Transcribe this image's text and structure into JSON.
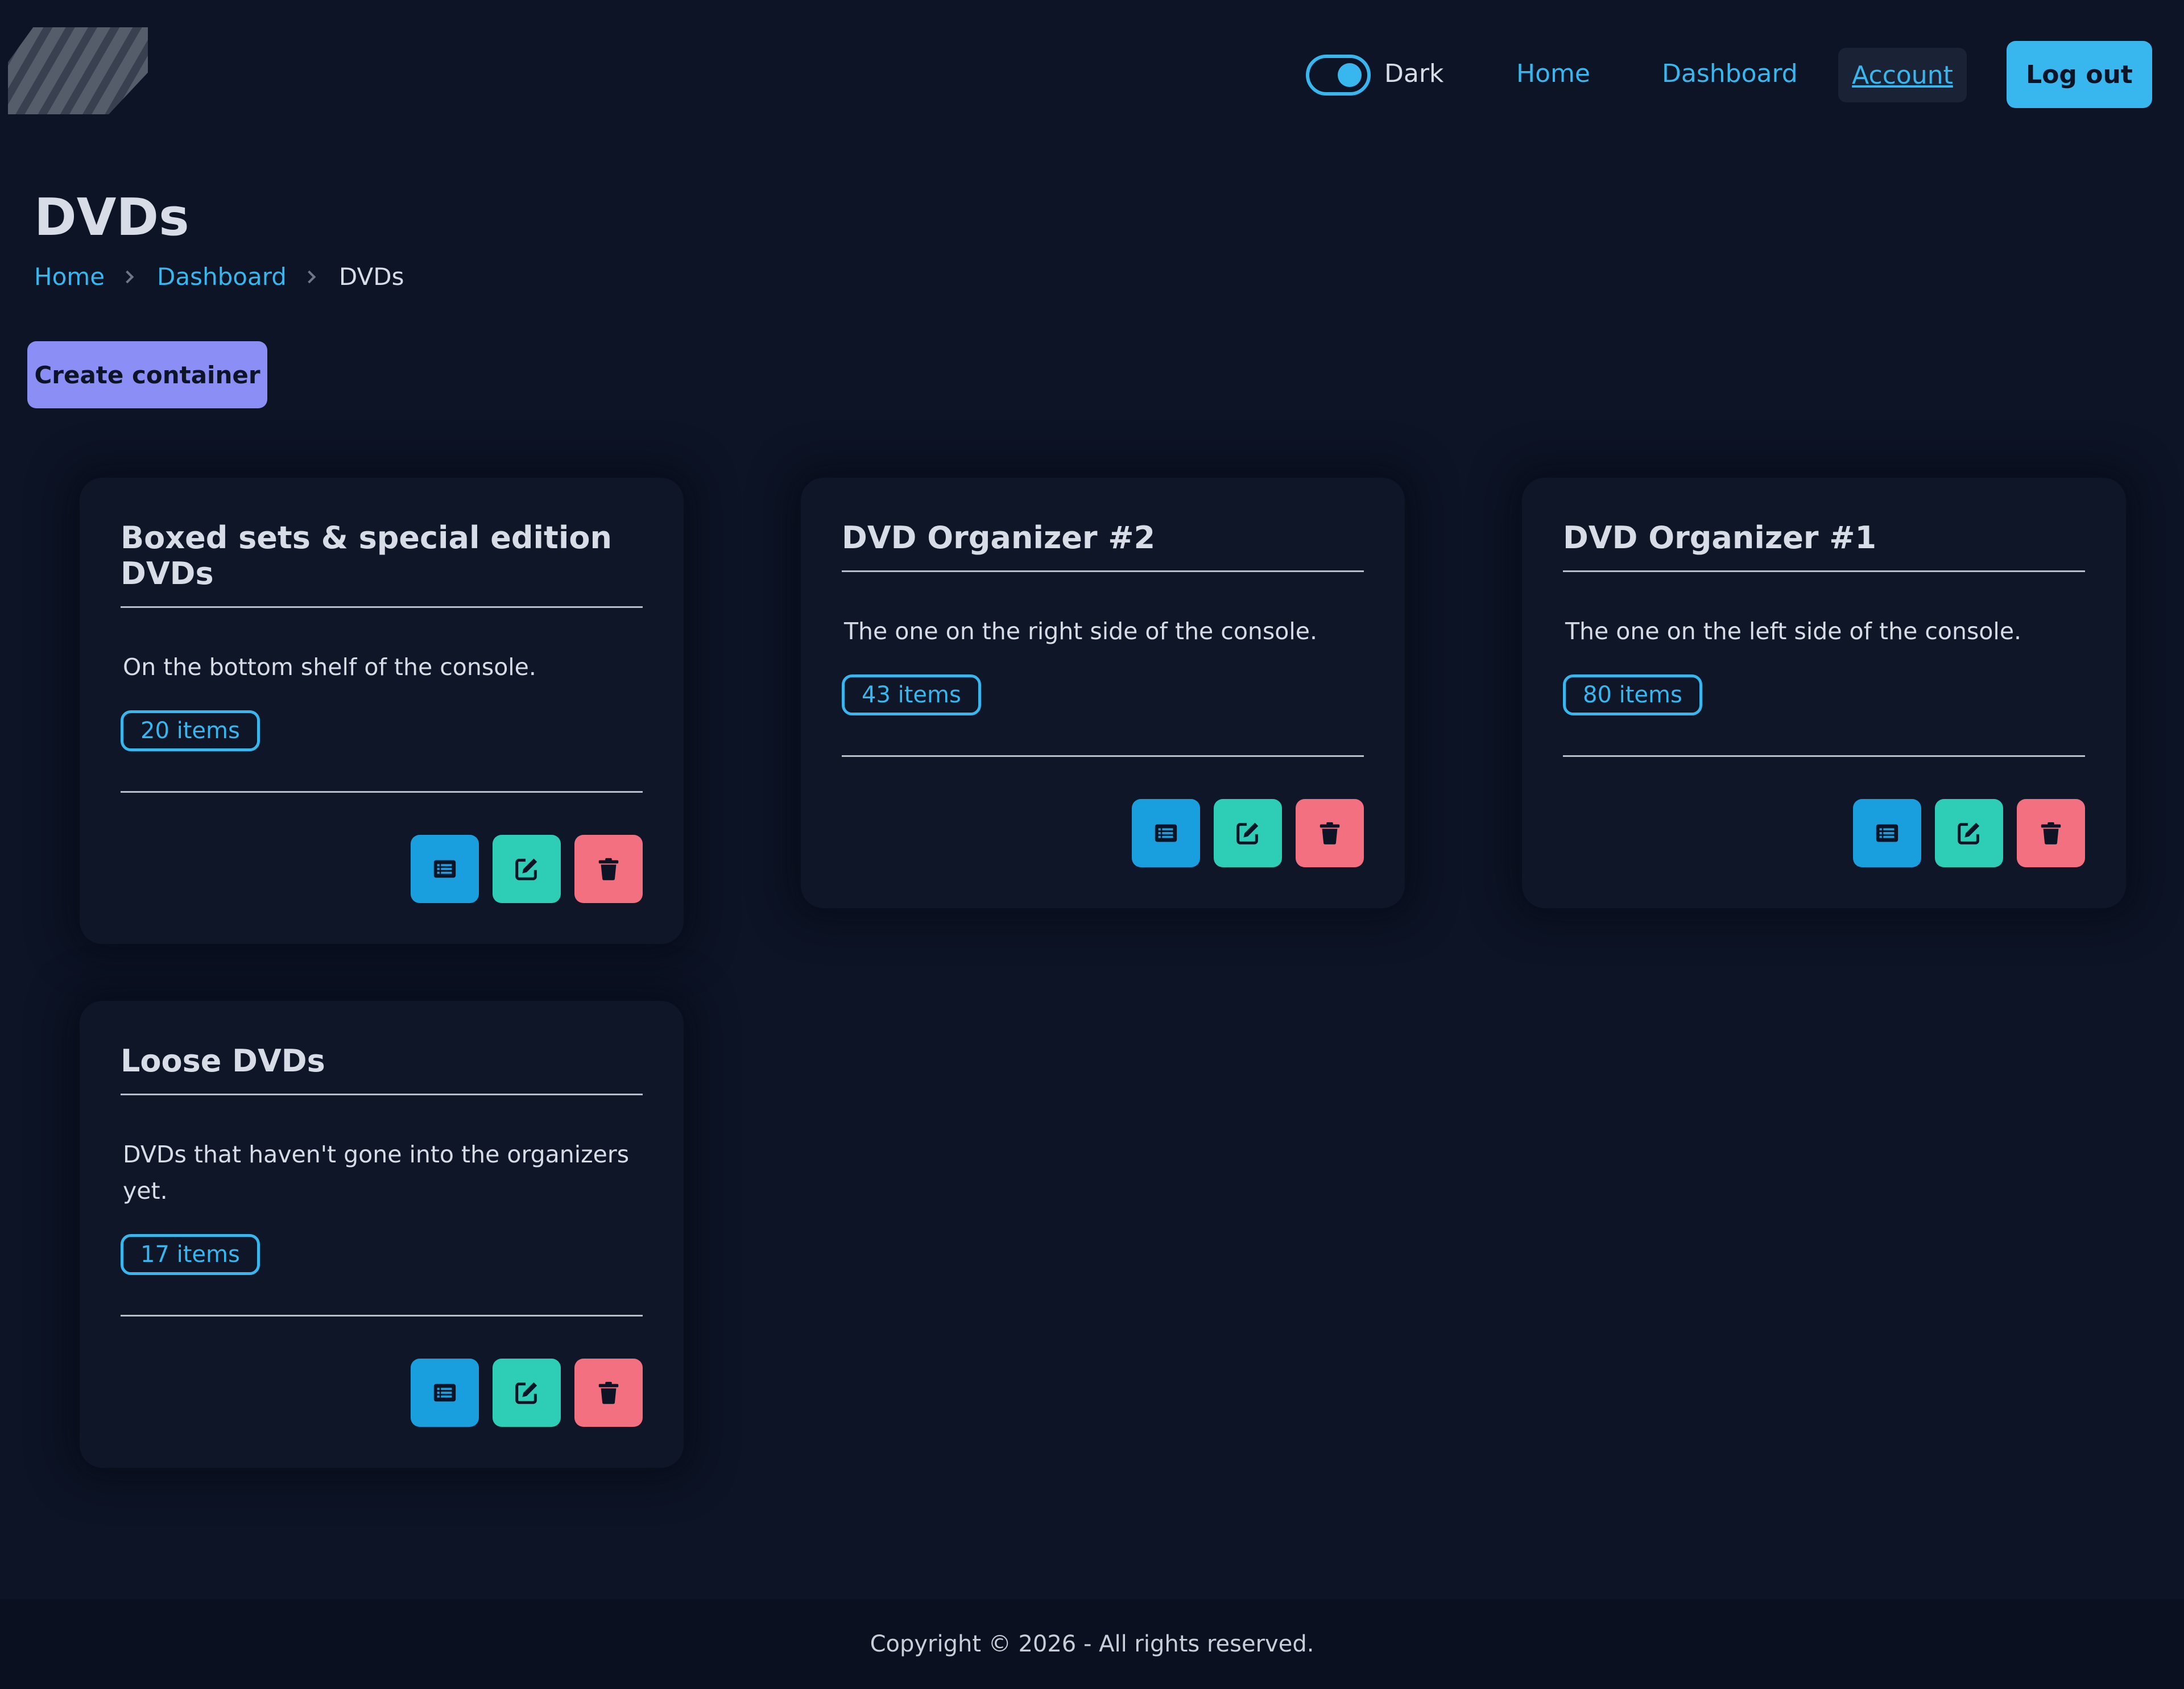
{
  "header": {
    "logo_alt": "",
    "theme": {
      "label": "Dark",
      "enabled": true
    },
    "nav": {
      "home": "Home",
      "dashboard": "Dashboard",
      "account": "Account",
      "logout": "Log out"
    }
  },
  "page": {
    "title": "DVDs",
    "breadcrumb": [
      "Home",
      "Dashboard",
      "DVDs"
    ],
    "create_button": "Create container"
  },
  "containers": [
    {
      "name": "Boxed sets & special edition DVDs",
      "description": "On the bottom shelf of the console.",
      "count": "20 items"
    },
    {
      "name": "DVD Organizer #2",
      "description": "The one on the right side of the console.",
      "count": "43 items"
    },
    {
      "name": "DVD Organizer #1",
      "description": "The one on the left side of the console.",
      "count": "80 items"
    },
    {
      "name": "Loose DVDs",
      "description": "DVDs that haven't gone into the organizers yet.",
      "count": "17 items"
    }
  ],
  "card_actions": {
    "view_icon": "list-icon",
    "edit_icon": "edit-icon",
    "delete_icon": "trash-icon"
  },
  "footer": {
    "copyright": "Copyright © 2026 - All rights reserved."
  },
  "colors": {
    "background": "#0d1426",
    "accent": "#38b6ee",
    "primary_button": "#8b8ff5",
    "view_button": "#1a9fde",
    "edit_button": "#2dcdb6",
    "delete_button": "#f2707f"
  }
}
